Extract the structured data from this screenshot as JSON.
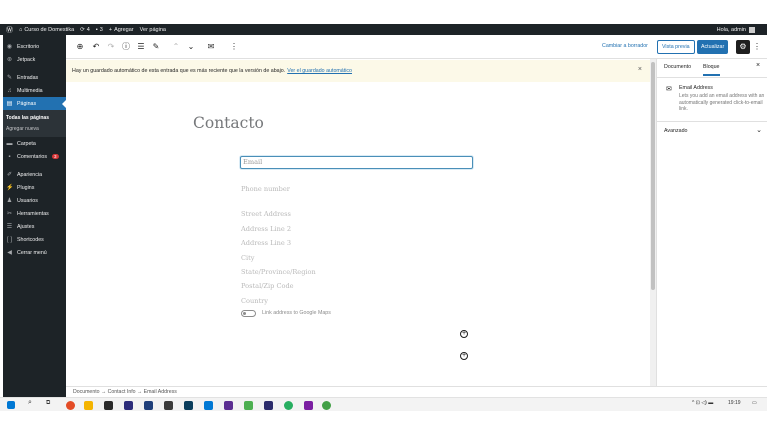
{
  "admin_bar": {
    "wp_logo": "wordpress-icon",
    "site_name": "Curso de Domestika",
    "updates_count": "4",
    "comments_count": "3",
    "new_label": "Agregar",
    "view_label": "Ver página",
    "greeting": "Hola, admin"
  },
  "sidebar": {
    "items": [
      {
        "label": "Escritorio",
        "icon": "dashboard-icon"
      },
      {
        "label": "Jetpack",
        "icon": "jetpack-icon"
      },
      {
        "label": "Entradas",
        "icon": "pin-icon"
      },
      {
        "label": "Multimedia",
        "icon": "media-icon"
      },
      {
        "label": "Páginas",
        "icon": "pages-icon"
      },
      {
        "label": "Carpeta",
        "icon": "folder-icon"
      },
      {
        "label": "Comentarios",
        "icon": "comments-icon",
        "badge": "3"
      },
      {
        "label": "Apariencia",
        "icon": "appearance-icon"
      },
      {
        "label": "Plugins",
        "icon": "plugins-icon"
      },
      {
        "label": "Usuarios",
        "icon": "users-icon"
      },
      {
        "label": "Herramientas",
        "icon": "tools-icon"
      },
      {
        "label": "Ajustes",
        "icon": "settings-icon"
      },
      {
        "label": "Shortcodes",
        "icon": "shortcode-icon"
      },
      {
        "label": "Cerrar menú",
        "icon": "collapse-icon"
      }
    ],
    "pages_submenu": [
      "Todas las páginas",
      "Agregar nueva"
    ]
  },
  "toolbar": {
    "switch_draft": "Cambiar a borrador",
    "preview": "Vista previa",
    "update": "Actualizar"
  },
  "notice": {
    "text": "Hay un guardado automático de esta entrada que es más reciente que la versión de abajo.",
    "link": "Ver el guardado automático",
    "close": "×"
  },
  "editor": {
    "title": "Contacto",
    "fields": {
      "email": "Email",
      "phone": "Phone number",
      "street1": "Street Address",
      "line2": "Address Line 2",
      "line3": "Address Line 3",
      "city": "City",
      "state": "State/Province/Region",
      "zip": "Postal/Zip Code",
      "country": "Country"
    },
    "map_toggle": "Link address to Google Maps"
  },
  "settings": {
    "tab_document": "Documento",
    "tab_block": "Bloque",
    "close": "×",
    "block_name": "Email Address",
    "block_desc": "Lets you add an email address with an automatically generated click-to-email link.",
    "advanced": "Avanzado"
  },
  "breadcrumb": "Documento → Contact Info → Email Address",
  "taskbar": {
    "time": "19:19",
    "tray": "^ ⊡ ◁) ▬"
  }
}
